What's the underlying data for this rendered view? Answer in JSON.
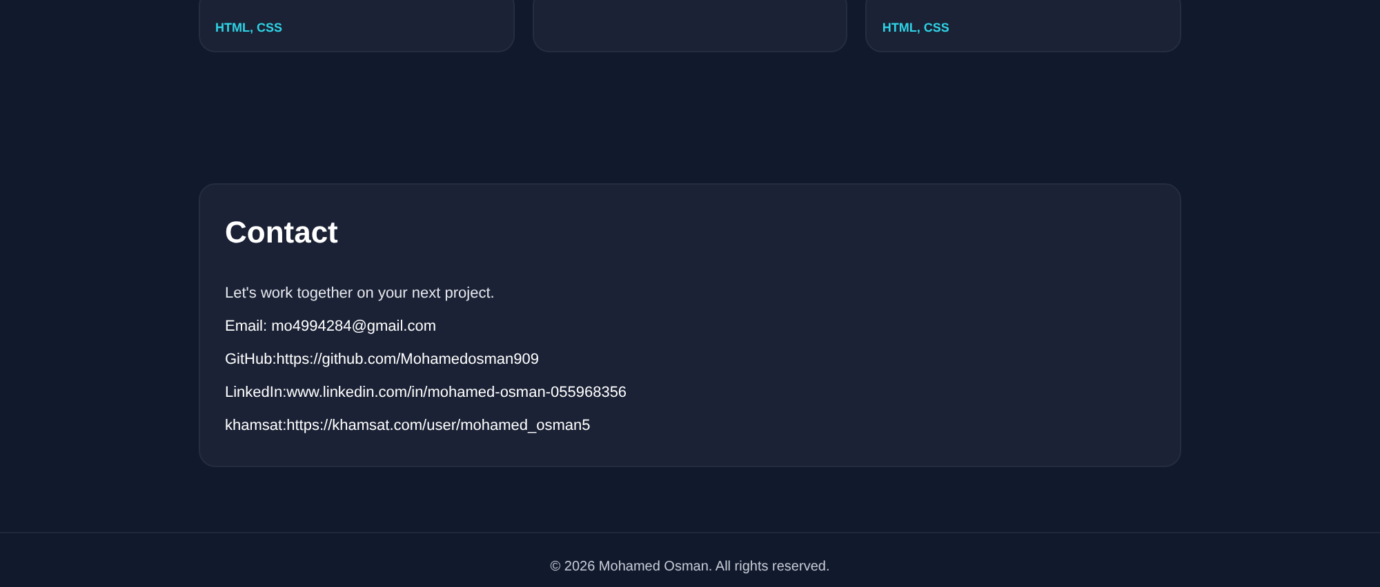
{
  "projects": [
    {
      "kind": "tagged",
      "tags": "HTML, CSS"
    },
    {
      "kind": "blank"
    },
    {
      "kind": "tagged",
      "tags": "HTML, CSS"
    }
  ],
  "contact": {
    "title": "Contact",
    "intro": "Let's work together on your next project.",
    "lines": [
      {
        "label": "Email:",
        "value": " mo4994284@gmail.com"
      },
      {
        "label": "GitHub:",
        "value": "https://github.com/Mohamedosman909"
      },
      {
        "label": "LinkedIn:",
        "value": "www.linkedin.com/in/mohamed-osman-055968356"
      },
      {
        "label": "khamsat:",
        "value": "https://khamsat.com/user/mohamed_osman5"
      }
    ]
  },
  "footer": "© 2026 Mohamed Osman. All rights reserved."
}
